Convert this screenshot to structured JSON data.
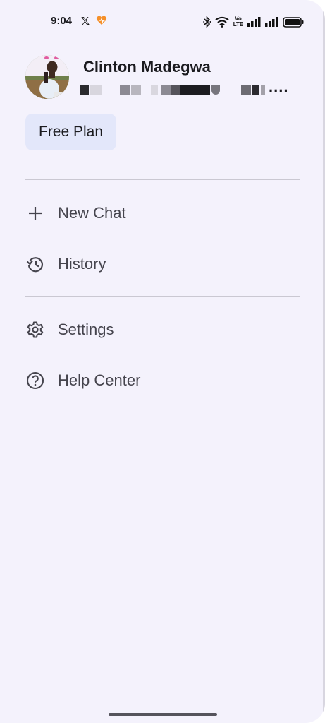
{
  "status_bar": {
    "time": "9:04",
    "x_glyph": "𝕏",
    "icons": [
      "x-app-icon",
      "heart-app-icon",
      "bluetooth-icon",
      "wifi-icon",
      "volte-icon",
      "signal-icon",
      "signal-icon",
      "battery-icon"
    ],
    "volte_top": "Vo",
    "volte_bottom": "LTE"
  },
  "profile": {
    "name": "Clinton Madegwa",
    "email_visible_tail": "....",
    "avatar": "user-avatar-photo"
  },
  "plan": {
    "label": "Free Plan"
  },
  "menu": {
    "new_chat": {
      "label": "New Chat",
      "icon": "plus-icon"
    },
    "history": {
      "label": "History",
      "icon": "history-icon"
    },
    "settings": {
      "label": "Settings",
      "icon": "gear-icon"
    },
    "help_center": {
      "label": "Help Center",
      "icon": "help-circle-icon"
    }
  },
  "colors": {
    "drawer_background": "#f4f2fc",
    "chip_background": "#e3e7fa",
    "text_primary": "#1b1b1f",
    "text_secondary": "#45444d",
    "divider": "#cac8d2",
    "accent_orange": "#f5902a"
  }
}
